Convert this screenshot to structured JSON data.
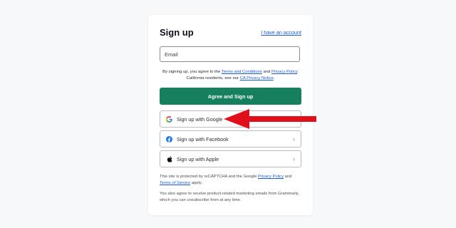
{
  "signup": {
    "title": "Sign up",
    "have_account_link": "I have an account",
    "email_placeholder": "Email",
    "terms": {
      "prefix": "By signing up, you agree to the ",
      "terms_link": "Terms and Conditions",
      "and": " and ",
      "privacy_link": "Privacy Policy",
      "middle": ". California residents, see our ",
      "ca_link": "CA Privacy Notice",
      "suffix": "."
    },
    "primary_button": "Agree and Sign up",
    "social": [
      {
        "label": "Sign up with Google",
        "icon": "google-icon"
      },
      {
        "label": "Sign up with Facebook",
        "icon": "facebook-icon"
      },
      {
        "label": "Sign up with Apple",
        "icon": "apple-icon"
      }
    ],
    "recaptcha": {
      "prefix": "This site is protected by reCAPTCHA and the Google ",
      "privacy_link": "Privacy Policy",
      "and": " and ",
      "tos_link": "Terms of Service",
      "suffix": " apply."
    },
    "marketing_text": "You also agree to receive product-related marketing emails from Grammarly, which you can unsubscribe from at any time."
  },
  "colors": {
    "primary": "#16805e",
    "link": "#1a5ad7",
    "annotation_arrow": "#e0101a",
    "facebook": "#1877f2"
  }
}
